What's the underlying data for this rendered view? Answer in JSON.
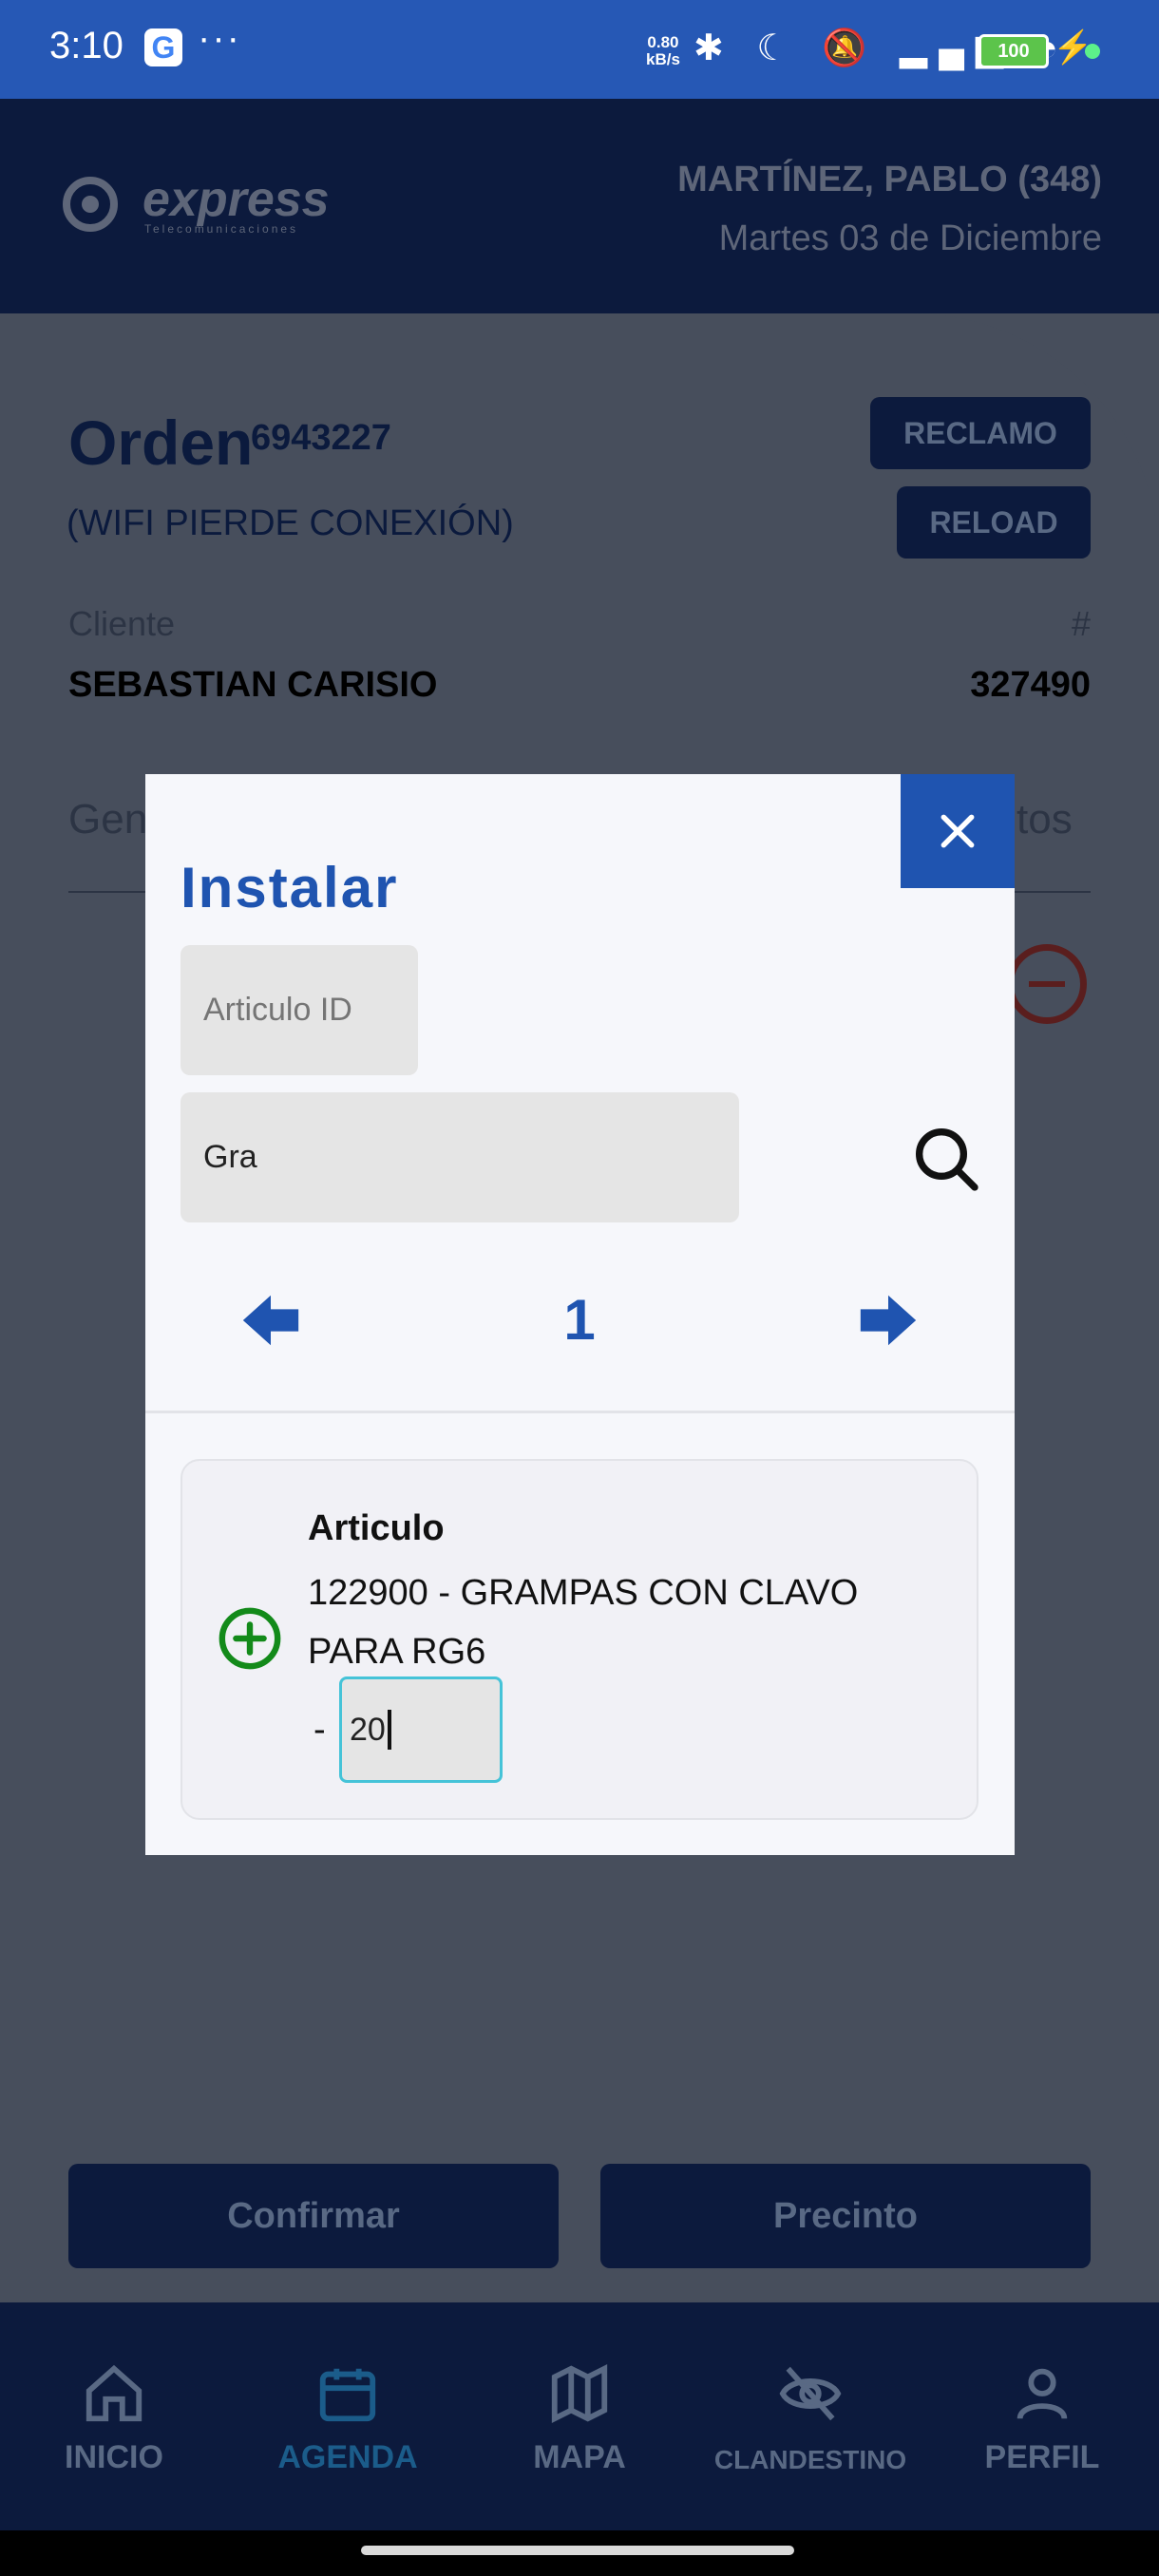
{
  "status_bar": {
    "time": "3:10",
    "google_icon_letter": "G",
    "more": "···",
    "net_speed": "0.80",
    "net_unit": "kB/s",
    "icons": "✱ ☾ 🔕 ▂▄▆ ◔",
    "battery": "100",
    "charging": "⚡"
  },
  "header": {
    "logo_text": "express",
    "logo_subtext": "Telecomunicaciones",
    "user": "MARTÍNEZ, PABLO (348)",
    "date": "Martes 03 de Diciembre"
  },
  "order": {
    "title": "Orden",
    "number": "6943227",
    "description": "(WIFI PIERDE CONEXIÓN)",
    "reclamo_label": "RECLAMO",
    "reload_label": "RELOAD",
    "cliente_label": "Cliente",
    "hash_label": "#",
    "cliente_name": "SEBASTIAN CARISIO",
    "cliente_number": "327490",
    "partial_left": "Gen",
    "partial_right": "tos"
  },
  "actions": {
    "confirmar": "Confirmar",
    "precinto": "Precinto"
  },
  "bottom_nav": [
    {
      "label": "INICIO",
      "icon": "home-icon"
    },
    {
      "label": "AGENDA",
      "icon": "calendar-icon",
      "active": true
    },
    {
      "label": "MAPA",
      "icon": "map-icon"
    },
    {
      "label": "CLANDESTINO",
      "icon": "eye-off-icon"
    },
    {
      "label": "PERFIL",
      "icon": "user-icon"
    }
  ],
  "modal": {
    "title": "Instalar",
    "close_icon": "close-icon",
    "articulo_id_placeholder": "Articulo ID",
    "search_value": "Gra",
    "page": "1",
    "item": {
      "label": "Articulo",
      "description": "122900 - GRAMPAS CON CLAVO PARA RG6",
      "qty_prefix": "-",
      "qty_value": "20"
    }
  },
  "colors": {
    "status_bar": "#2658b5",
    "primary": "#1f54b0",
    "dark_navy": "#0c1a3d",
    "overlay": "#474e5c",
    "add_green": "#138a1a",
    "focus_border": "#45c3d8"
  }
}
